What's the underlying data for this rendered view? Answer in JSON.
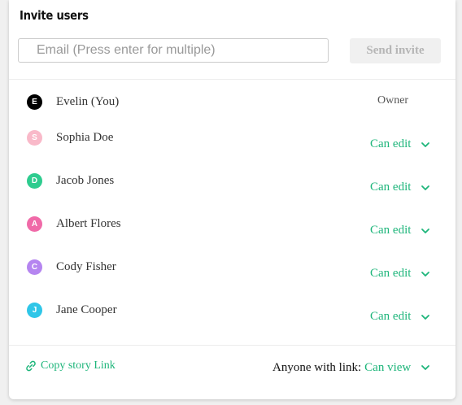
{
  "panel": {
    "title": "Invite users"
  },
  "invite": {
    "email_placeholder": "Email (Press enter for multiple)",
    "email_value": "",
    "send_label": "Send invite"
  },
  "users": [
    {
      "initial": "E",
      "name": "Evelin (You)",
      "role": "Owner",
      "avatar_color": "#000000"
    },
    {
      "initial": "S",
      "name": "Sophia Doe",
      "role": "Can edit",
      "avatar_color": "#f9b9c9"
    },
    {
      "initial": "D",
      "name": "Jacob Jones",
      "role": "Can edit",
      "avatar_color": "#2ecc8f"
    },
    {
      "initial": "A",
      "name": "Albert Flores",
      "role": "Can edit",
      "avatar_color": "#f06aa8"
    },
    {
      "initial": "C",
      "name": "Cody Fisher",
      "role": "Can edit",
      "avatar_color": "#b585f0"
    },
    {
      "initial": "J",
      "name": "Jane Cooper",
      "role": "Can edit",
      "avatar_color": "#2fc6e8"
    }
  ],
  "footer": {
    "copy_link_label": "Copy story Link",
    "anyone_label": "Anyone with link:",
    "anyone_permission": "Can view"
  },
  "colors": {
    "accent": "#1db57a",
    "owner_text": "#555555"
  },
  "icons": {
    "permission_dropdown": "chevron-down-icon",
    "copy_link": "link-icon"
  }
}
